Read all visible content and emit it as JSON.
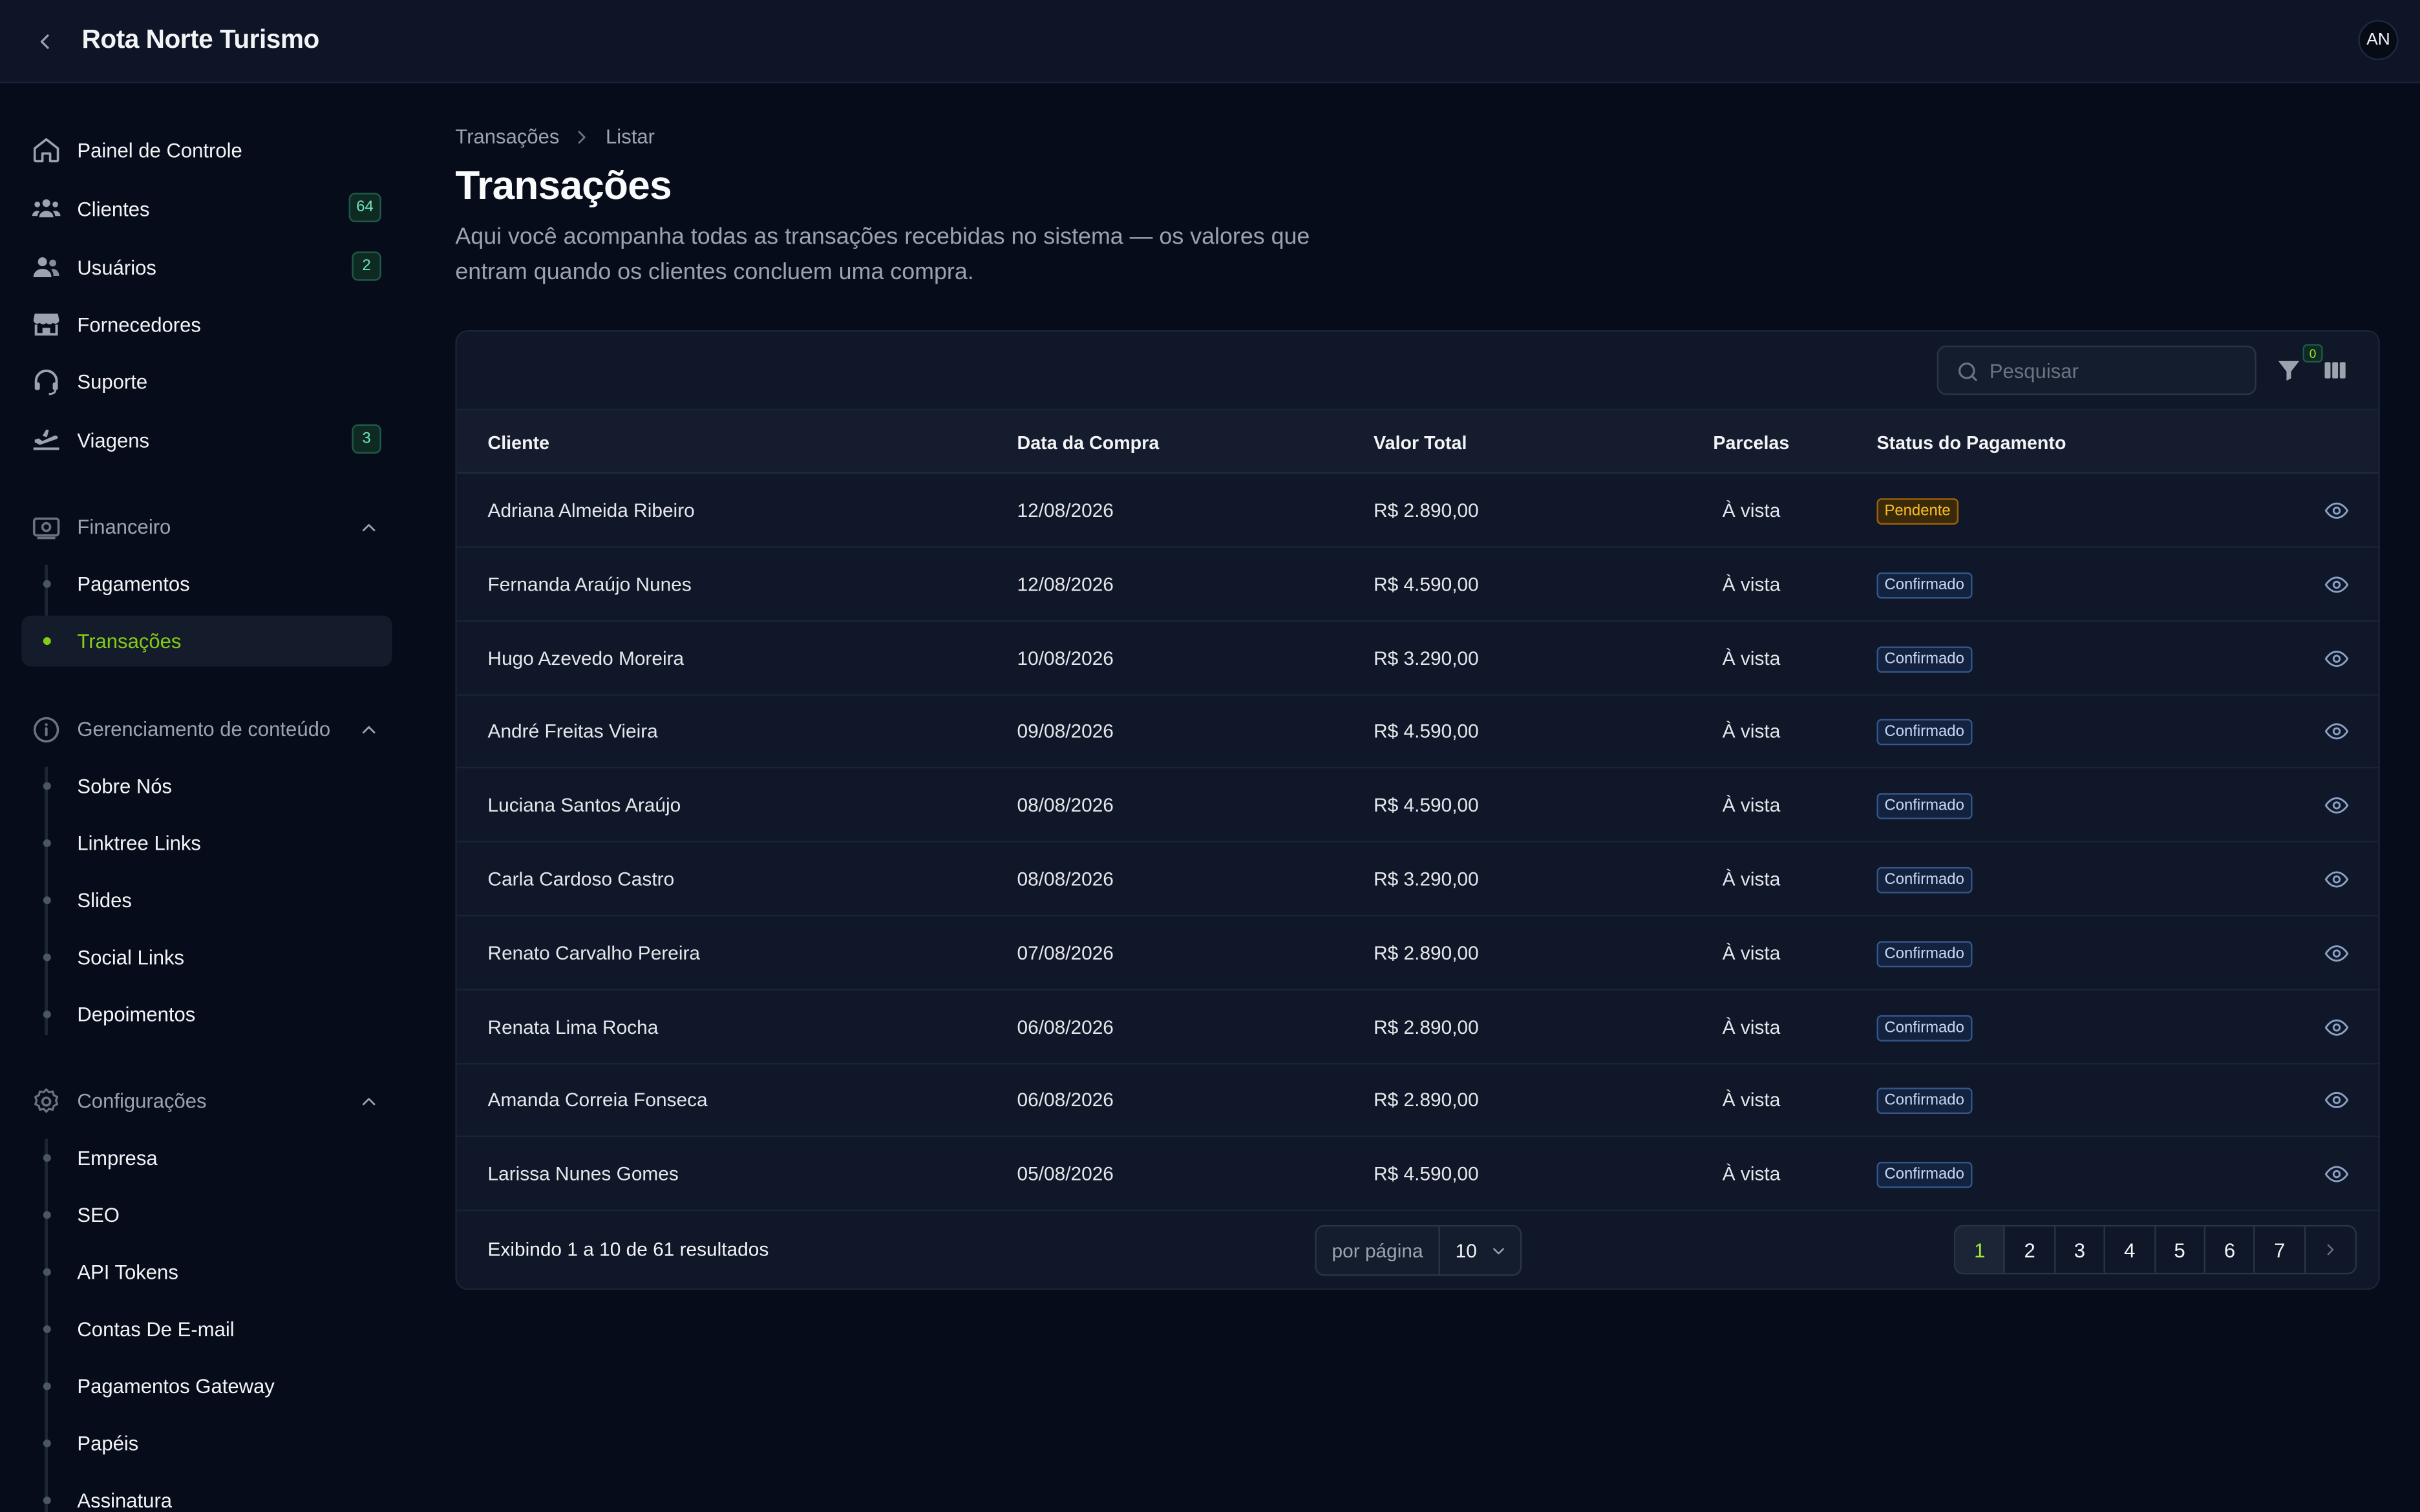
{
  "app": {
    "title": "Rota Norte Turismo",
    "avatar_initials": "AN"
  },
  "sidebar": {
    "main_items": [
      {
        "label": "Painel de Controle",
        "icon": "home-icon",
        "badge": ""
      },
      {
        "label": "Clientes",
        "icon": "users-group-icon",
        "badge": "64"
      },
      {
        "label": "Usuários",
        "icon": "users-icon",
        "badge": "2"
      },
      {
        "label": "Fornecedores",
        "icon": "store-icon",
        "badge": ""
      },
      {
        "label": "Suporte",
        "icon": "headset-icon",
        "badge": ""
      },
      {
        "label": "Viagens",
        "icon": "plane-icon",
        "badge": "3"
      }
    ],
    "groups": [
      {
        "label": "Financeiro",
        "icon": "money-icon",
        "items": [
          "Pagamentos",
          "Transações"
        ],
        "active": "Transações"
      },
      {
        "label": "Gerenciamento de conteúdo",
        "icon": "info-icon",
        "items": [
          "Sobre Nós",
          "Linktree Links",
          "Slides",
          "Social Links",
          "Depoimentos"
        ]
      },
      {
        "label": "Configurações",
        "icon": "gear-icon",
        "items": [
          "Empresa",
          "SEO",
          "API Tokens",
          "Contas De E-mail",
          "Pagamentos Gateway",
          "Papéis",
          "Assinatura"
        ]
      }
    ]
  },
  "breadcrumb": [
    "Transações",
    "Listar"
  ],
  "page": {
    "title": "Transações",
    "description": "Aqui você acompanha todas as transações recebidas no sistema — os valores que entram quando os clientes concluem uma compra."
  },
  "toolbar": {
    "search_placeholder": "Pesquisar",
    "filter_count": "0"
  },
  "table": {
    "columns": [
      "Cliente",
      "Data da Compra",
      "Valor Total",
      "Parcelas",
      "Status do Pagamento"
    ],
    "rows": [
      {
        "cliente": "Adriana Almeida Ribeiro",
        "data": "12/08/2026",
        "valor": "R$ 2.890,00",
        "parcelas": "À vista",
        "status": "Pendente"
      },
      {
        "cliente": "Fernanda Araújo Nunes",
        "data": "12/08/2026",
        "valor": "R$ 4.590,00",
        "parcelas": "À vista",
        "status": "Confirmado"
      },
      {
        "cliente": "Hugo Azevedo Moreira",
        "data": "10/08/2026",
        "valor": "R$ 3.290,00",
        "parcelas": "À vista",
        "status": "Confirmado"
      },
      {
        "cliente": "André Freitas Vieira",
        "data": "09/08/2026",
        "valor": "R$ 4.590,00",
        "parcelas": "À vista",
        "status": "Confirmado"
      },
      {
        "cliente": "Luciana Santos Araújo",
        "data": "08/08/2026",
        "valor": "R$ 4.590,00",
        "parcelas": "À vista",
        "status": "Confirmado"
      },
      {
        "cliente": "Carla Cardoso Castro",
        "data": "08/08/2026",
        "valor": "R$ 3.290,00",
        "parcelas": "À vista",
        "status": "Confirmado"
      },
      {
        "cliente": "Renato Carvalho Pereira",
        "data": "07/08/2026",
        "valor": "R$ 2.890,00",
        "parcelas": "À vista",
        "status": "Confirmado"
      },
      {
        "cliente": "Renata Lima Rocha",
        "data": "06/08/2026",
        "valor": "R$ 2.890,00",
        "parcelas": "À vista",
        "status": "Confirmado"
      },
      {
        "cliente": "Amanda Correia Fonseca",
        "data": "06/08/2026",
        "valor": "R$ 2.890,00",
        "parcelas": "À vista",
        "status": "Confirmado"
      },
      {
        "cliente": "Larissa Nunes Gomes",
        "data": "05/08/2026",
        "valor": "R$ 4.590,00",
        "parcelas": "À vista",
        "status": "Confirmado"
      }
    ]
  },
  "footer": {
    "summary": "Exibindo 1 a 10 de 61 resultados",
    "per_page_label": "por página",
    "per_page_value": "10",
    "pages": [
      "1",
      "2",
      "3",
      "4",
      "5",
      "6",
      "7"
    ],
    "current_page": "1"
  },
  "colors": {
    "background": "#070c1b",
    "card": "#0f1728",
    "accent": "#84cc16",
    "pending": "#fbbf24",
    "confirmed": "#c7d7f5"
  }
}
